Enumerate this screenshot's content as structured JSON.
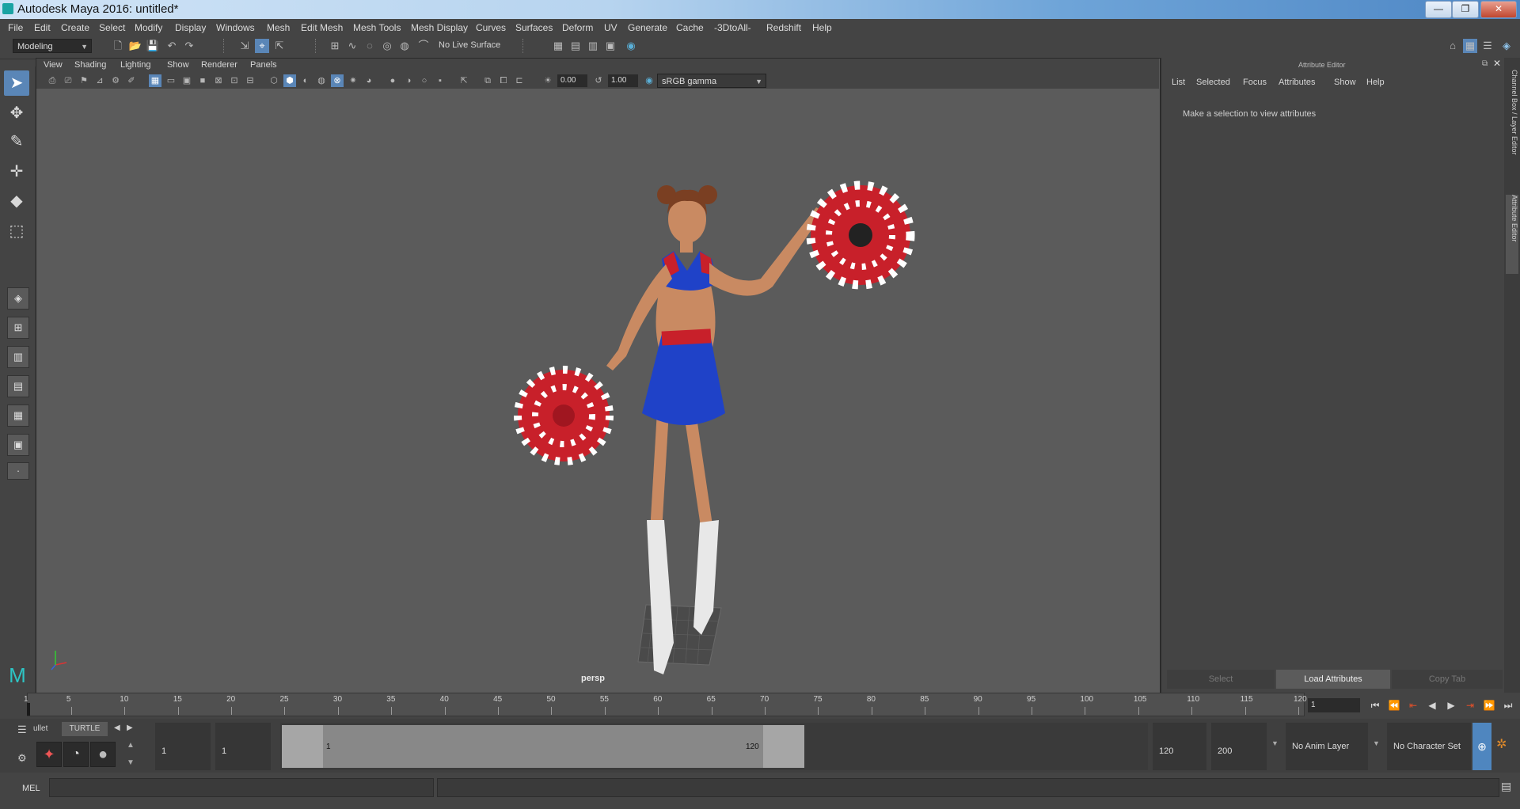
{
  "window": {
    "title": "Autodesk Maya 2016: untitled*",
    "minimize": "—",
    "restore": "❐",
    "close": "✕"
  },
  "menubar": {
    "items": [
      "File",
      "Edit",
      "Create",
      "Select",
      "Modify",
      "Display",
      "Windows",
      "Mesh",
      "Edit Mesh",
      "Mesh Tools",
      "Mesh Display",
      "Curves",
      "Surfaces",
      "Deform",
      "UV",
      "Generate",
      "Cache",
      "-3DtoAll-",
      "Redshift",
      "Help"
    ]
  },
  "statusline": {
    "menu_set": "Modeling",
    "live_surface": "No Live Surface"
  },
  "panel": {
    "menus": [
      "View",
      "Shading",
      "Lighting",
      "Show",
      "Renderer",
      "Panels"
    ],
    "exposure": "0.00",
    "gamma": "1.00",
    "color_space": "sRGB gamma",
    "camera": "persp"
  },
  "attribute_editor": {
    "title": "Attribute Editor",
    "menus": [
      "List",
      "Selected",
      "Focus",
      "Attributes",
      "Show",
      "Help"
    ],
    "message": "Make a selection to view attributes",
    "buttons": {
      "select": "Select",
      "load": "Load Attributes",
      "copy": "Copy Tab"
    },
    "side_tabs": {
      "channel_box": "Channel Box / Layer Editor",
      "attribute_editor": "Attribute Editor"
    }
  },
  "timeslider": {
    "ticks": [
      "1",
      "5",
      "10",
      "15",
      "20",
      "25",
      "30",
      "35",
      "40",
      "45",
      "50",
      "55",
      "60",
      "65",
      "70",
      "75",
      "80",
      "85",
      "90",
      "95",
      "100",
      "105",
      "110",
      "115",
      "120"
    ],
    "current_frame": "1"
  },
  "range": {
    "shelf_tabs": {
      "prev": "ullet",
      "turtle": "TURTLE"
    },
    "start_frame": "1",
    "playback_start": "1",
    "range_start_label": "1",
    "range_end_label": "120",
    "playback_end": "120",
    "end_frame": "200",
    "anim_layer": "No Anim Layer",
    "character_set": "No Character Set"
  },
  "cmdline": {
    "label": "MEL"
  },
  "colors": {
    "accent": "#5a86b7",
    "pom_red": "#c8202a",
    "outfit_blue": "#1f42c8",
    "viewport_bg": "#5b5b5b"
  }
}
